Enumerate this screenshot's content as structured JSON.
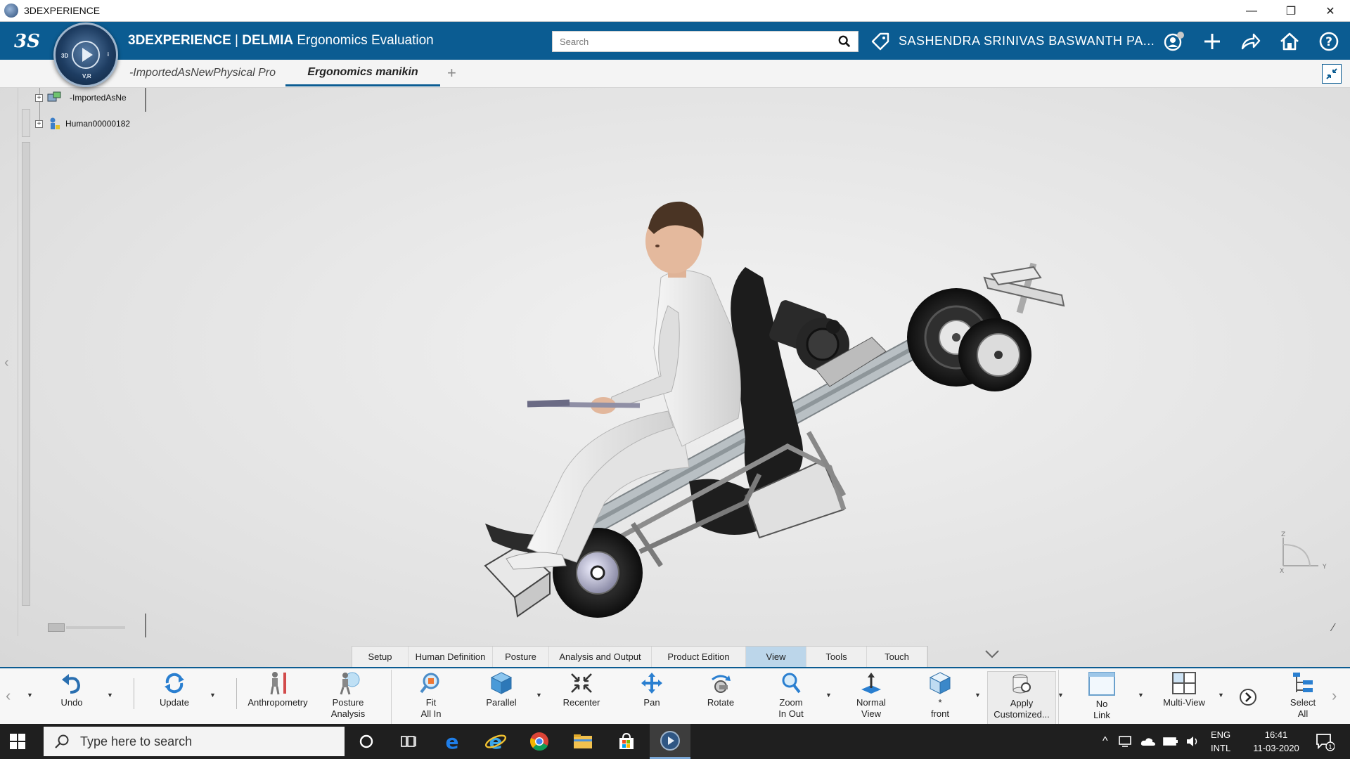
{
  "os_window": {
    "title": "3DEXPERIENCE"
  },
  "app_header": {
    "brand": "3DEXPERIENCE",
    "separator": " | ",
    "product": "DELMIA",
    "app_name": " Ergonomics Evaluation",
    "search_placeholder": "Search",
    "user_name": "SASHENDRA SRINIVAS BASWANTH PA...",
    "accent_color": "#0b5c92",
    "compass_labels": {
      "left": "3D",
      "right": "i",
      "bottom": "V,R"
    }
  },
  "tabs": [
    {
      "label": "-ImportedAsNewPhysical Pro",
      "active": false
    },
    {
      "label": "Ergonomics manikin",
      "active": true
    }
  ],
  "tree": [
    {
      "label": "-ImportedAsNe",
      "icon": "product-icon"
    },
    {
      "label": "Human00000182",
      "icon": "manikin-icon"
    }
  ],
  "axis": {
    "z": "Z",
    "x": "X",
    "y": "Y"
  },
  "action_tabs": [
    {
      "label": "Setup",
      "active": false
    },
    {
      "label": "Human Definition",
      "active": false
    },
    {
      "label": "Posture",
      "active": false
    },
    {
      "label": "Analysis and Output",
      "active": false
    },
    {
      "label": "Product Edition",
      "active": false
    },
    {
      "label": "View",
      "active": true
    },
    {
      "label": "Tools",
      "active": false
    },
    {
      "label": "Touch",
      "active": false
    }
  ],
  "toolbar": {
    "undo": "Undo",
    "update": "Update",
    "anthropometry": "Anthropometry",
    "posture_analysis_1": "Posture",
    "posture_analysis_2": "Analysis",
    "fit_all_in_1": "Fit",
    "fit_all_in_2": "All In",
    "parallel": "Parallel",
    "recenter": "Recenter",
    "pan": "Pan",
    "rotate": "Rotate",
    "zoom_1": "Zoom",
    "zoom_2": "In Out",
    "normal_view_1": "Normal",
    "normal_view_2": "View",
    "front_1": "*",
    "front_2": "front",
    "apply_1": "Apply",
    "apply_2": "Customized...",
    "no_link_1": "No",
    "no_link_2": "Link",
    "multi_view": "Multi-View",
    "select_all_1": "Select",
    "select_all_2": "All"
  },
  "taskbar": {
    "search_placeholder": "Type here to search",
    "lang_1": "ENG",
    "lang_2": "INTL",
    "time": "16:41",
    "date": "11-03-2020",
    "notification_count": "1"
  }
}
